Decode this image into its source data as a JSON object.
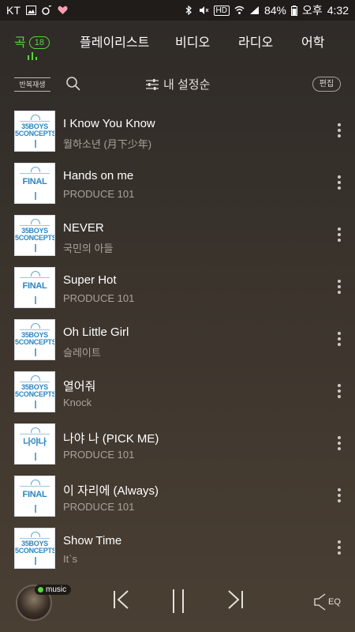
{
  "status_bar": {
    "carrier": "KT",
    "hd": "HD",
    "battery": "84%",
    "ampm": "오후",
    "time": "4:32"
  },
  "tabs": [
    {
      "label": "곡",
      "badge": "18",
      "active": true
    },
    {
      "label": "플레이리스트"
    },
    {
      "label": "비디오"
    },
    {
      "label": "라디오"
    },
    {
      "label": "어학"
    }
  ],
  "toolbar": {
    "repeat_label": "반복재생",
    "sort_label": "내 설정순",
    "edit_label": "편집"
  },
  "songs": [
    {
      "title": "I Know You Know",
      "artist": "월하소년 (月下少年)",
      "cover": "35BOYS 5CONCEPTS"
    },
    {
      "title": "Hands on me",
      "artist": "PRODUCE 101",
      "cover": "FINAL"
    },
    {
      "title": "NEVER",
      "artist": "국민의 아들",
      "cover": "35BOYS 5CONCEPTS"
    },
    {
      "title": "Super Hot",
      "artist": "PRODUCE 101",
      "cover": "FINAL"
    },
    {
      "title": "Oh Little Girl",
      "artist": "슬레이트",
      "cover": "35BOYS 5CONCEPTS"
    },
    {
      "title": "열어줘",
      "artist": "Knock",
      "cover": "35BOYS 5CONCEPTS"
    },
    {
      "title": "나야 나 (PICK ME)",
      "artist": "PRODUCE 101",
      "cover": "나야나"
    },
    {
      "title": "이 자리에 (Always)",
      "artist": "PRODUCE 101",
      "cover": "FINAL"
    },
    {
      "title": "Show Time",
      "artist": "It`s",
      "cover": "35BOYS 5CONCEPTS"
    }
  ],
  "player": {
    "music_tag": "music",
    "eq_label": "EQ"
  },
  "colors": {
    "accent": "#58d53f",
    "cover_text": "#2d86c2"
  }
}
